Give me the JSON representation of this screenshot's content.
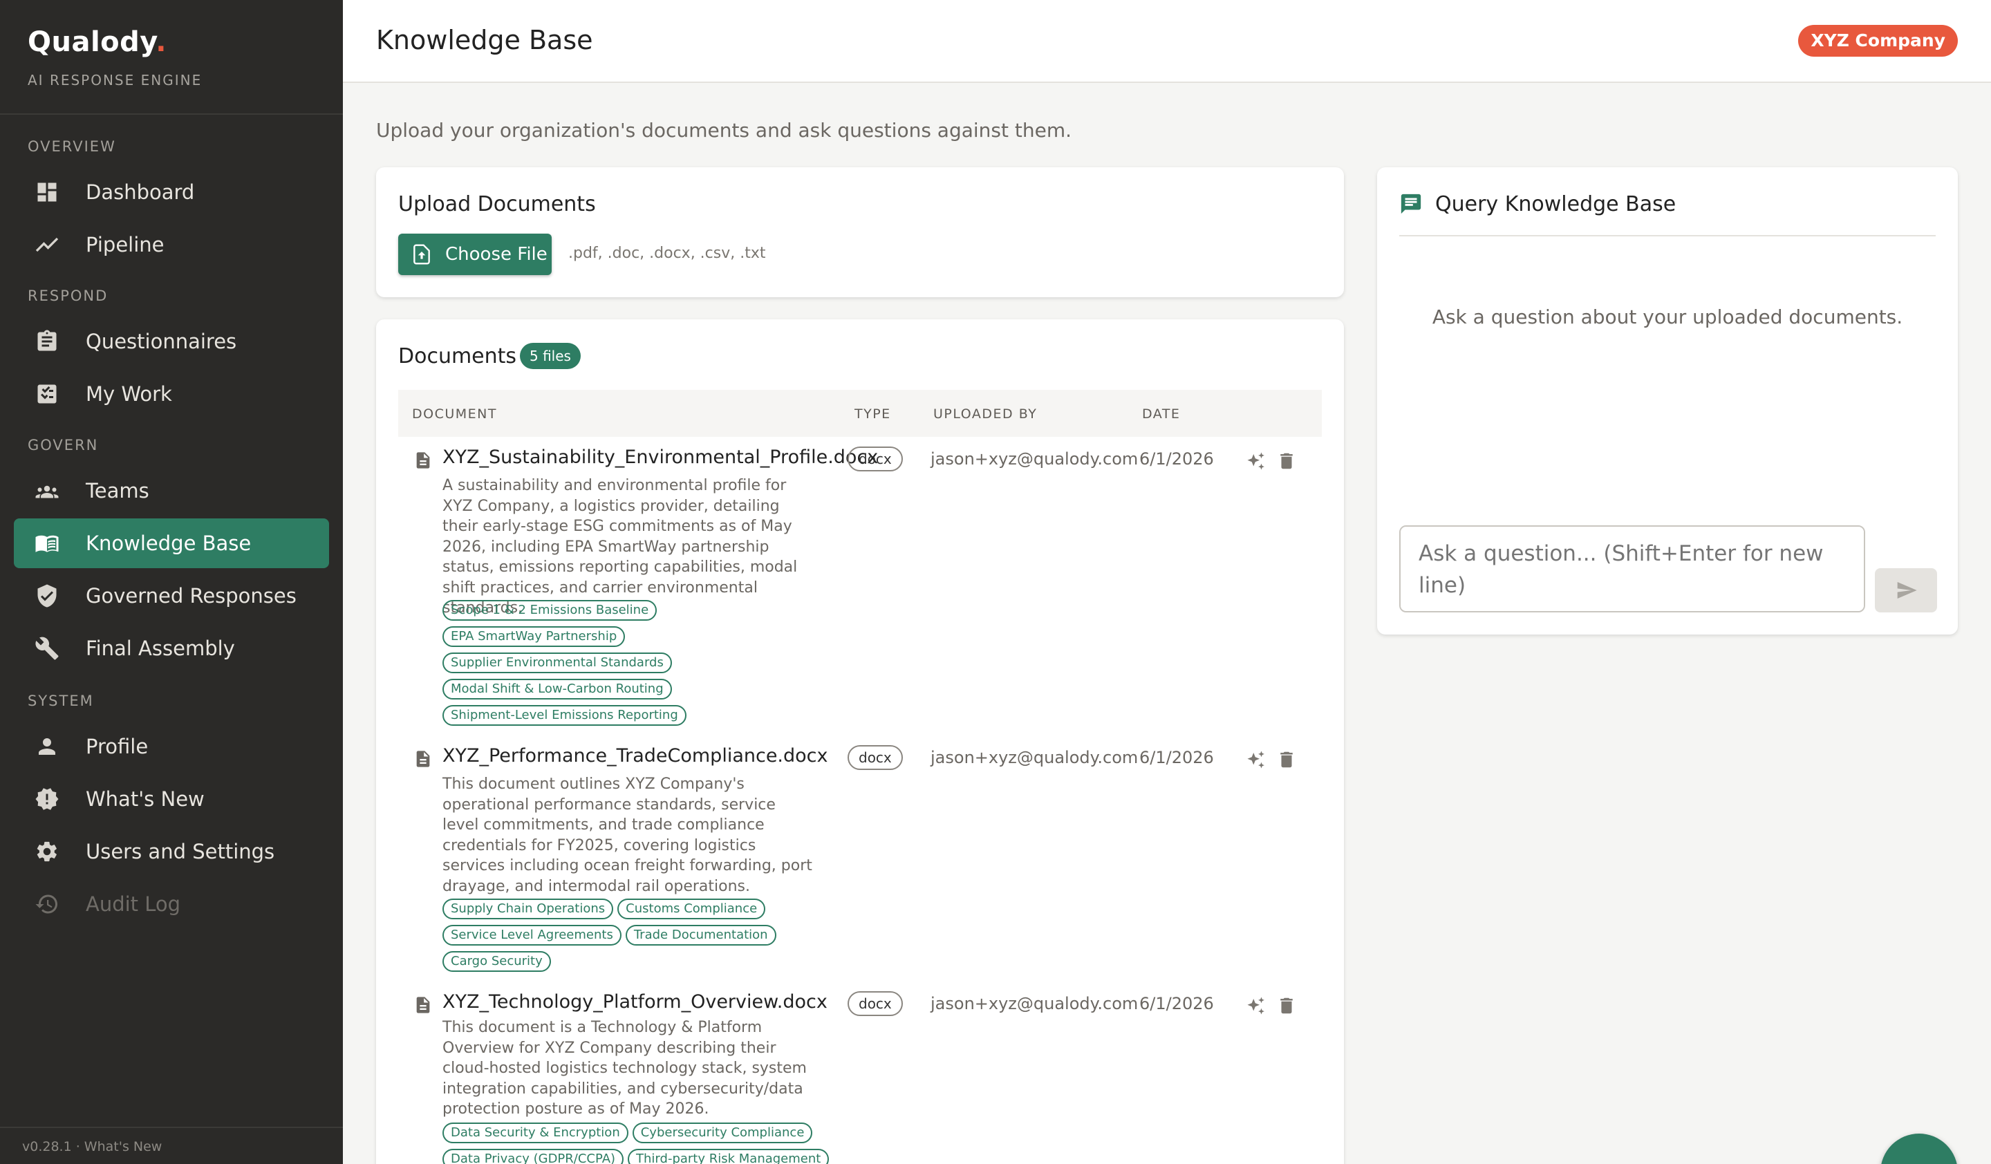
{
  "brand": {
    "name": "Qualody",
    "dot": ".",
    "subtitle": "AI RESPONSE ENGINE"
  },
  "sidebar": {
    "sections": {
      "overview": "OVERVIEW",
      "respond": "RESPOND",
      "govern": "GOVERN",
      "system": "SYSTEM"
    },
    "items": [
      {
        "label": "Dashboard",
        "icon": "dashboard-icon"
      },
      {
        "label": "Pipeline",
        "icon": "trending-icon"
      },
      {
        "label": "Questionnaires",
        "icon": "clipboard-icon"
      },
      {
        "label": "My Work",
        "icon": "checklist-icon"
      },
      {
        "label": "Teams",
        "icon": "group-icon"
      },
      {
        "label": "Knowledge Base",
        "icon": "book-icon",
        "active": true
      },
      {
        "label": "Governed Responses",
        "icon": "shield-check-icon"
      },
      {
        "label": "Final Assembly",
        "icon": "wrench-icon"
      },
      {
        "label": "Profile",
        "icon": "person-icon"
      },
      {
        "label": "What's New",
        "icon": "new-badge-icon"
      },
      {
        "label": "Users and Settings",
        "icon": "gear-icon"
      },
      {
        "label": "Audit Log",
        "icon": "history-icon",
        "disabled": true
      }
    ],
    "version": "v0.28.1 · What's New"
  },
  "header": {
    "title": "Knowledge Base",
    "company": "XYZ Company"
  },
  "subtitle": "Upload your organization's documents and ask questions against them.",
  "upload": {
    "title": "Upload Documents",
    "button": "Choose File",
    "file_types": ".pdf, .doc, .docx, .csv, .txt"
  },
  "documents": {
    "title": "Documents",
    "count": "5 files",
    "columns": {
      "document": "DOCUMENT",
      "type": "TYPE",
      "uploaded_by": "UPLOADED BY",
      "date": "DATE"
    },
    "rows": [
      {
        "name": "XYZ_Sustainability_Environmental_Profile.docx",
        "description": "A sustainability and environmental profile for XYZ Company, a logistics provider, detailing their early-stage ESG commitments as of May 2026, including EPA SmartWay partnership status, emissions reporting capabilities, modal shift practices, and carrier environmental standards.",
        "tags": [
          "Scope 1 & 2 Emissions Baseline",
          "EPA SmartWay Partnership",
          "Supplier Environmental Standards",
          "Modal Shift & Low-Carbon Routing",
          "Shipment-Level Emissions Reporting"
        ],
        "type": "docx",
        "uploaded_by": "jason+xyz@qualody.com",
        "date": "6/1/2026"
      },
      {
        "name": "XYZ_Performance_TradeCompliance.docx",
        "description": "This document outlines XYZ Company's operational performance standards, service level commitments, and trade compliance credentials for FY2025, covering logistics services including ocean freight forwarding, port drayage, and intermodal rail operations.",
        "tags": [
          "Supply Chain Operations",
          "Customs Compliance",
          "Service Level Agreements",
          "Trade Documentation",
          "Cargo Security"
        ],
        "type": "docx",
        "uploaded_by": "jason+xyz@qualody.com",
        "date": "6/1/2026"
      },
      {
        "name": "XYZ_Technology_Platform_Overview.docx",
        "description": "This document is a Technology & Platform Overview for XYZ Company describing their cloud-hosted logistics technology stack, system integration capabilities, and cybersecurity/data protection posture as of May 2026.",
        "tags": [
          "Data Security & Encryption",
          "Cybersecurity Compliance",
          "Data Privacy (GDPR/CCPA)",
          "Third-party Risk Management"
        ],
        "type": "docx",
        "uploaded_by": "jason+xyz@qualody.com",
        "date": "6/1/2026"
      }
    ]
  },
  "query": {
    "title": "Query Knowledge Base",
    "empty_state": "Ask a question about your uploaded documents.",
    "placeholder": "Ask a question... (Shift+Enter for new line)"
  },
  "colors": {
    "accent": "#2e7d63",
    "brand": "#e8583d",
    "sidebar": "#2b2a28"
  }
}
